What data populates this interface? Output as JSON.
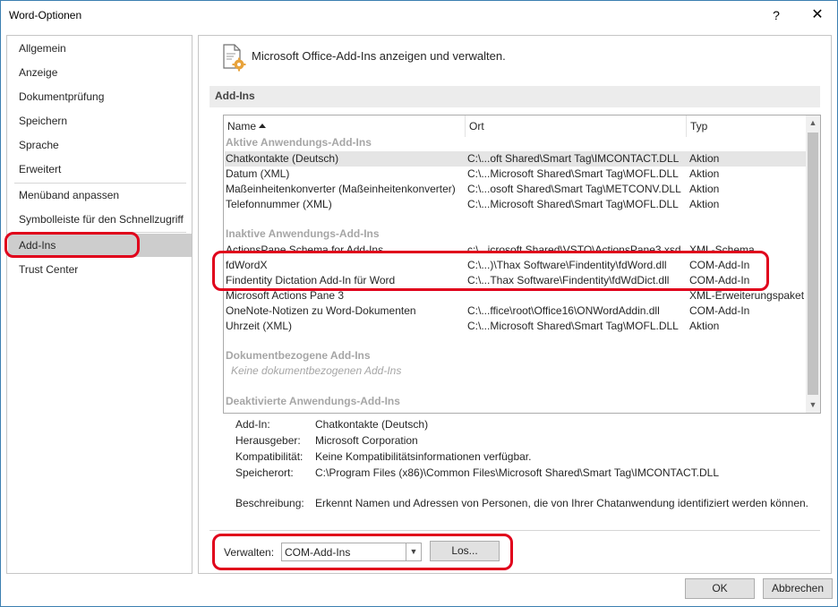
{
  "window": {
    "title": "Word-Optionen",
    "help": "?",
    "close": "✕"
  },
  "sidebar": {
    "items": [
      {
        "label": "Allgemein"
      },
      {
        "label": "Anzeige"
      },
      {
        "label": "Dokumentprüfung"
      },
      {
        "label": "Speichern"
      },
      {
        "label": "Sprache"
      },
      {
        "label": "Erweitert"
      },
      {
        "label": "Menüband anpassen"
      },
      {
        "label": "Symbolleiste für den Schnellzugriff"
      },
      {
        "label": "Add-Ins"
      },
      {
        "label": "Trust Center"
      }
    ],
    "selected": "Add-Ins"
  },
  "main": {
    "header": "Microsoft Office-Add-Ins anzeigen und verwalten.",
    "section_title": "Add-Ins",
    "columns": {
      "name": "Name",
      "location": "Ort",
      "type": "Typ"
    },
    "groups": {
      "active": "Aktive Anwendungs-Add-Ins",
      "inactive": "Inaktive Anwendungs-Add-Ins",
      "document": "Dokumentbezogene Add-Ins",
      "document_empty": "Keine dokumentbezogenen Add-Ins",
      "disabled": "Deaktivierte Anwendungs-Add-Ins"
    },
    "active_rows": [
      {
        "name": "Chatkontakte (Deutsch)",
        "location": "C:\\...oft Shared\\Smart Tag\\IMCONTACT.DLL",
        "type": "Aktion"
      },
      {
        "name": "Datum (XML)",
        "location": "C:\\...Microsoft Shared\\Smart Tag\\MOFL.DLL",
        "type": "Aktion"
      },
      {
        "name": "Maßeinheitenkonverter (Maßeinheitenkonverter)",
        "location": "C:\\...osoft Shared\\Smart Tag\\METCONV.DLL",
        "type": "Aktion"
      },
      {
        "name": "Telefonnummer (XML)",
        "location": "C:\\...Microsoft Shared\\Smart Tag\\MOFL.DLL",
        "type": "Aktion"
      }
    ],
    "inactive_rows": [
      {
        "name": "ActionsPane Schema for Add-Ins",
        "location": "c:\\...icrosoft Shared\\VSTO\\ActionsPane3.xsd",
        "type": "XML-Schema"
      },
      {
        "name": "fdWordX",
        "location": "C:\\...)\\Thax Software\\Findentity\\fdWord.dll",
        "type": "COM-Add-In"
      },
      {
        "name": "Findentity Dictation Add-In für Word",
        "location": "C:\\...Thax Software\\Findentity\\fdWdDict.dll",
        "type": "COM-Add-In"
      },
      {
        "name": "Microsoft Actions Pane 3",
        "location": "",
        "type": "XML-Erweiterungspaket"
      },
      {
        "name": "OneNote-Notizen zu Word-Dokumenten",
        "location": "C:\\...ffice\\root\\Office16\\ONWordAddin.dll",
        "type": "COM-Add-In"
      },
      {
        "name": "Uhrzeit (XML)",
        "location": "C:\\...Microsoft Shared\\Smart Tag\\MOFL.DLL",
        "type": "Aktion"
      }
    ],
    "details": {
      "addin_label": "Add-In:",
      "addin_value": "Chatkontakte (Deutsch)",
      "publisher_label": "Herausgeber:",
      "publisher_value": "Microsoft Corporation",
      "compat_label": "Kompatibilität:",
      "compat_value": "Keine Kompatibilitätsinformationen verfügbar.",
      "location_label": "Speicherort:",
      "location_value": "C:\\Program Files (x86)\\Common Files\\Microsoft Shared\\Smart Tag\\IMCONTACT.DLL",
      "desc_label": "Beschreibung:",
      "desc_value": "Erkennt Namen und Adressen von Personen, die von Ihrer Chatanwendung identifiziert werden können."
    },
    "manage": {
      "label": "Verwalten:",
      "selected": "COM-Add-Ins",
      "go_button": "Los..."
    }
  },
  "footer": {
    "ok": "OK",
    "cancel": "Abbrechen"
  },
  "colors": {
    "highlight": "#e0001b",
    "selected_nav": "#cdcdcd",
    "section_bar": "#ececec"
  }
}
